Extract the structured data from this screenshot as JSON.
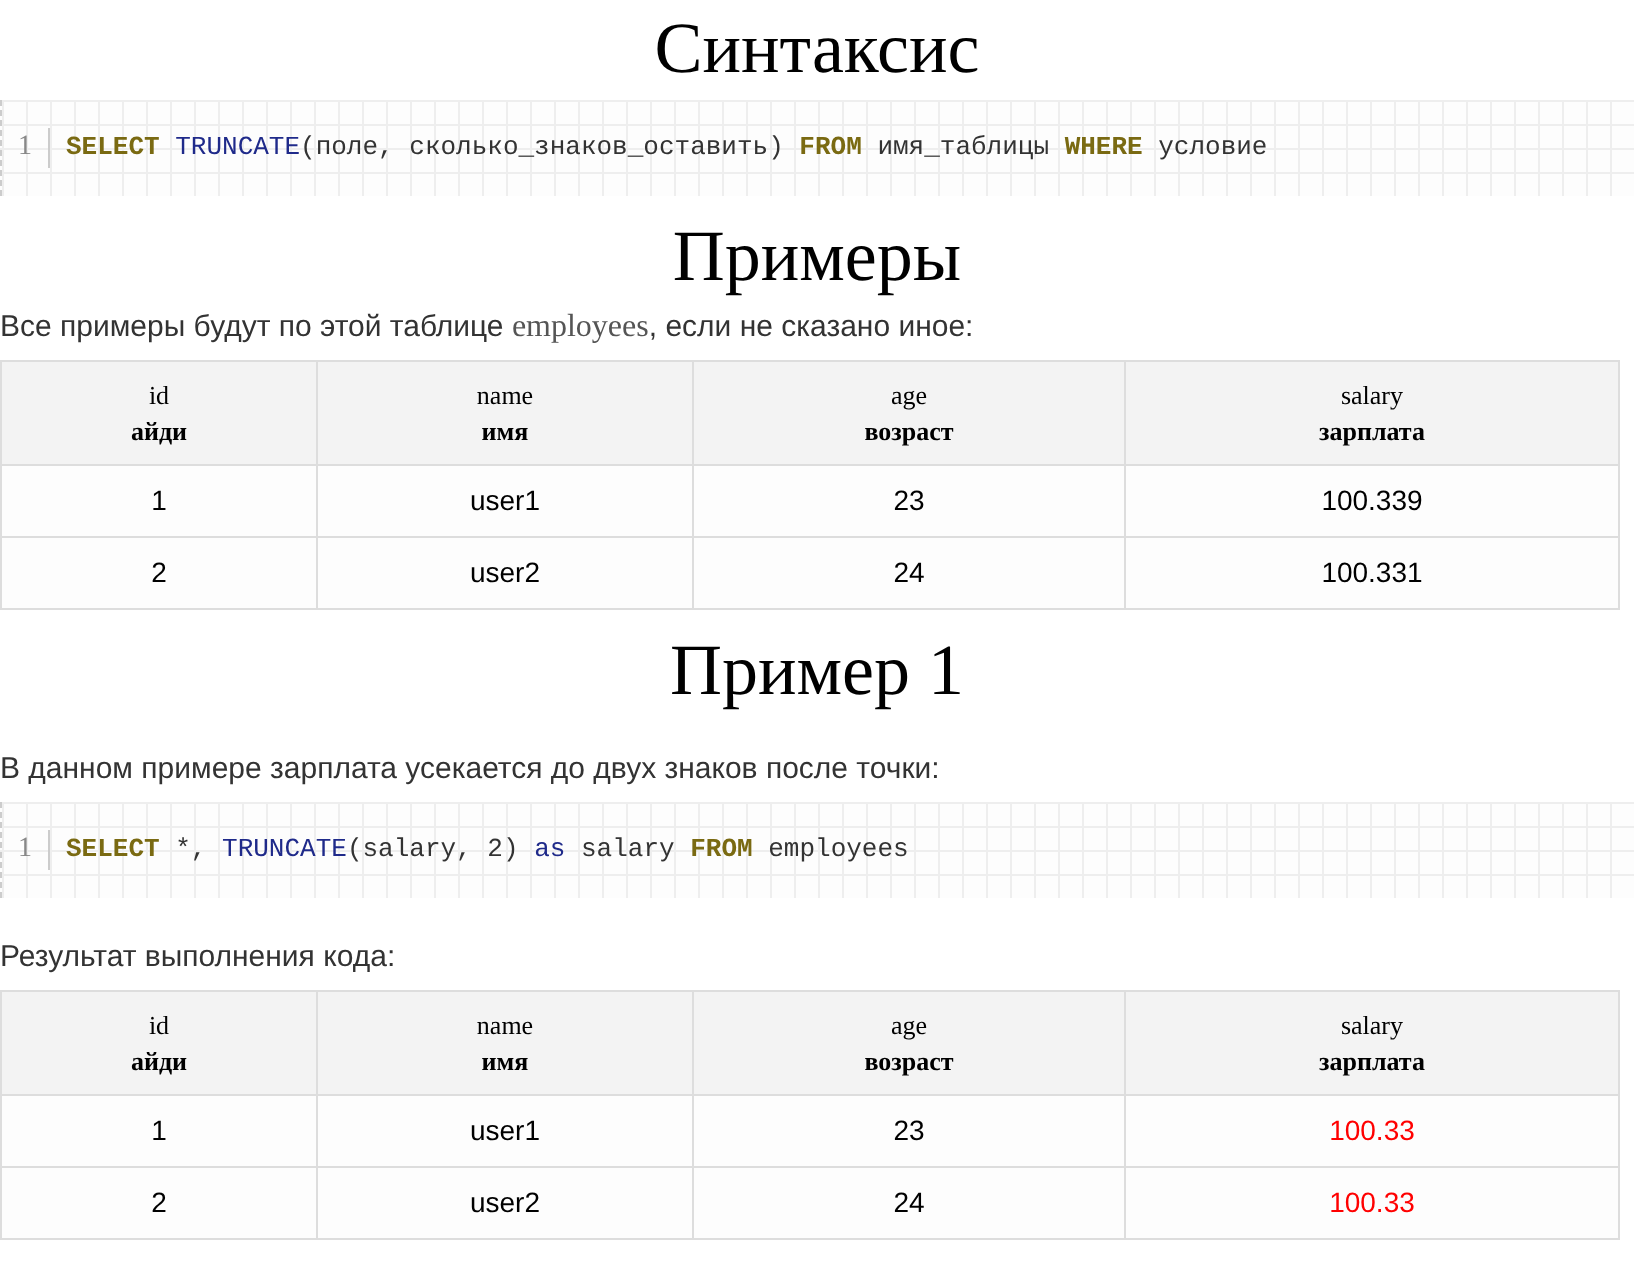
{
  "sections": [
    {
      "kind": "heading",
      "text": "Синтаксис"
    },
    {
      "kind": "code",
      "line_number": "1",
      "tokens": [
        {
          "kind": "keyword",
          "text": "SELECT "
        },
        {
          "kind": "function",
          "text": "TRUNCATE"
        },
        {
          "kind": "plain",
          "text": "(поле, сколько_знаков_оставить) "
        },
        {
          "kind": "keyword",
          "text": "FROM"
        },
        {
          "kind": "plain",
          "text": " имя_таблицы "
        },
        {
          "kind": "keyword",
          "text": "WHERE"
        },
        {
          "kind": "plain",
          "text": " условие"
        }
      ]
    },
    {
      "kind": "heading",
      "text": "Примеры"
    },
    {
      "kind": "paragraph",
      "parts": [
        {
          "kind": "plain",
          "text": "Все примеры будут по этой таблице "
        },
        {
          "kind": "serif",
          "text": "employees"
        },
        {
          "kind": "plain",
          "text": ", если не сказано иное:"
        }
      ]
    },
    {
      "kind": "table",
      "columns": [
        {
          "name": "id",
          "translation": "айди"
        },
        {
          "name": "name",
          "translation": "имя"
        },
        {
          "name": "age",
          "translation": "возраст"
        },
        {
          "name": "salary",
          "translation": "зарплата"
        }
      ],
      "rows": [
        [
          {
            "text": "1",
            "highlighted": false
          },
          {
            "text": "user1",
            "highlighted": false
          },
          {
            "text": "23",
            "highlighted": false
          },
          {
            "text": "100.339",
            "highlighted": false
          }
        ],
        [
          {
            "text": "2",
            "highlighted": false
          },
          {
            "text": "user2",
            "highlighted": false
          },
          {
            "text": "24",
            "highlighted": false
          },
          {
            "text": "100.331",
            "highlighted": false
          }
        ]
      ]
    },
    {
      "kind": "heading",
      "text": "Пример 1"
    },
    {
      "kind": "paragraph",
      "parts": [
        {
          "kind": "plain",
          "text": "В данном примере зарплата усекается до двух знаков после точки:"
        }
      ]
    },
    {
      "kind": "code",
      "line_number": "1",
      "tokens": [
        {
          "kind": "keyword",
          "text": "SELECT"
        },
        {
          "kind": "plain",
          "text": " *, "
        },
        {
          "kind": "function",
          "text": "TRUNCATE"
        },
        {
          "kind": "plain",
          "text": "(salary, 2) "
        },
        {
          "kind": "function",
          "text": "as"
        },
        {
          "kind": "plain",
          "text": " salary "
        },
        {
          "kind": "keyword",
          "text": "FROM"
        },
        {
          "kind": "plain",
          "text": " employees"
        }
      ]
    },
    {
      "kind": "paragraph",
      "parts": [
        {
          "kind": "plain",
          "text": "Результат выполнения кода:"
        }
      ]
    },
    {
      "kind": "table",
      "columns": [
        {
          "name": "id",
          "translation": "айди"
        },
        {
          "name": "name",
          "translation": "имя"
        },
        {
          "name": "age",
          "translation": "возраст"
        },
        {
          "name": "salary",
          "translation": "зарплата"
        }
      ],
      "rows": [
        [
          {
            "text": "1",
            "highlighted": false
          },
          {
            "text": "user1",
            "highlighted": false
          },
          {
            "text": "23",
            "highlighted": false
          },
          {
            "text": "100.33",
            "highlighted": true
          }
        ],
        [
          {
            "text": "2",
            "highlighted": false
          },
          {
            "text": "user2",
            "highlighted": false
          },
          {
            "text": "24",
            "highlighted": false
          },
          {
            "text": "100.33",
            "highlighted": true
          }
        ]
      ]
    }
  ]
}
